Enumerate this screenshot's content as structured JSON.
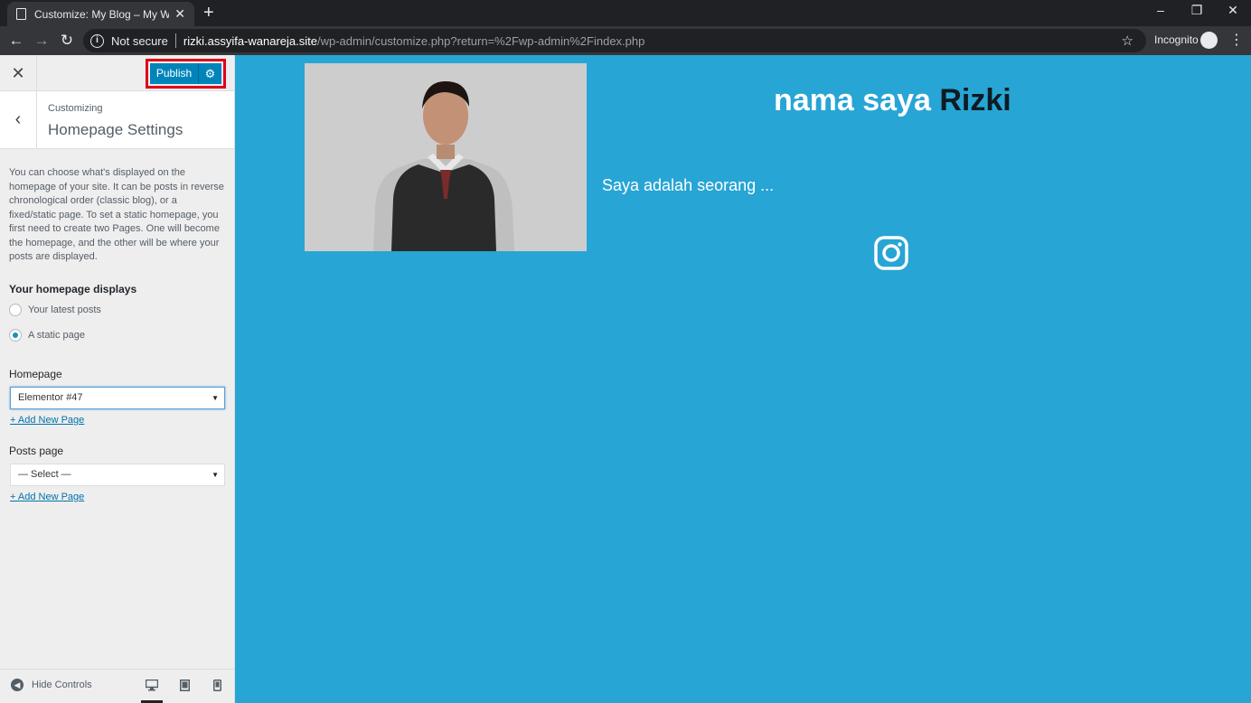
{
  "browser": {
    "tab_title": "Customize: My Blog – My WordP",
    "security_label": "Not secure",
    "url_host": "rizki.assyifa-wanareja.site",
    "url_path": "/wp-admin/customize.php?return=%2Fwp-admin%2Findex.php",
    "incognito_label": "Incognito"
  },
  "customizer": {
    "publish_label": "Publish",
    "breadcrumb": "Customizing",
    "section_title": "Homepage Settings",
    "description": "You can choose what's displayed on the homepage of your site. It can be posts in reverse chronological order (classic blog), or a fixed/static page. To set a static homepage, you first need to create two Pages. One will become the homepage, and the other will be where your posts are displayed.",
    "homepage_displays_label": "Your homepage displays",
    "options": [
      {
        "label": "Your latest posts",
        "checked": false
      },
      {
        "label": "A static page",
        "checked": true
      }
    ],
    "homepage_label": "Homepage",
    "homepage_value": "Elementor #47",
    "add_new_page": "+ Add New Page",
    "posts_page_label": "Posts page",
    "posts_page_value": "— Select —",
    "hide_controls": "Hide Controls",
    "accent_color": "#0085ba",
    "highlight_color": "#e0001a"
  },
  "preview": {
    "title_part1": "nama saya",
    "title_part2": "Rizki",
    "tagline": "Saya adalah seorang ...",
    "background_color": "#27a5d5",
    "social_icon": "instagram-icon"
  }
}
